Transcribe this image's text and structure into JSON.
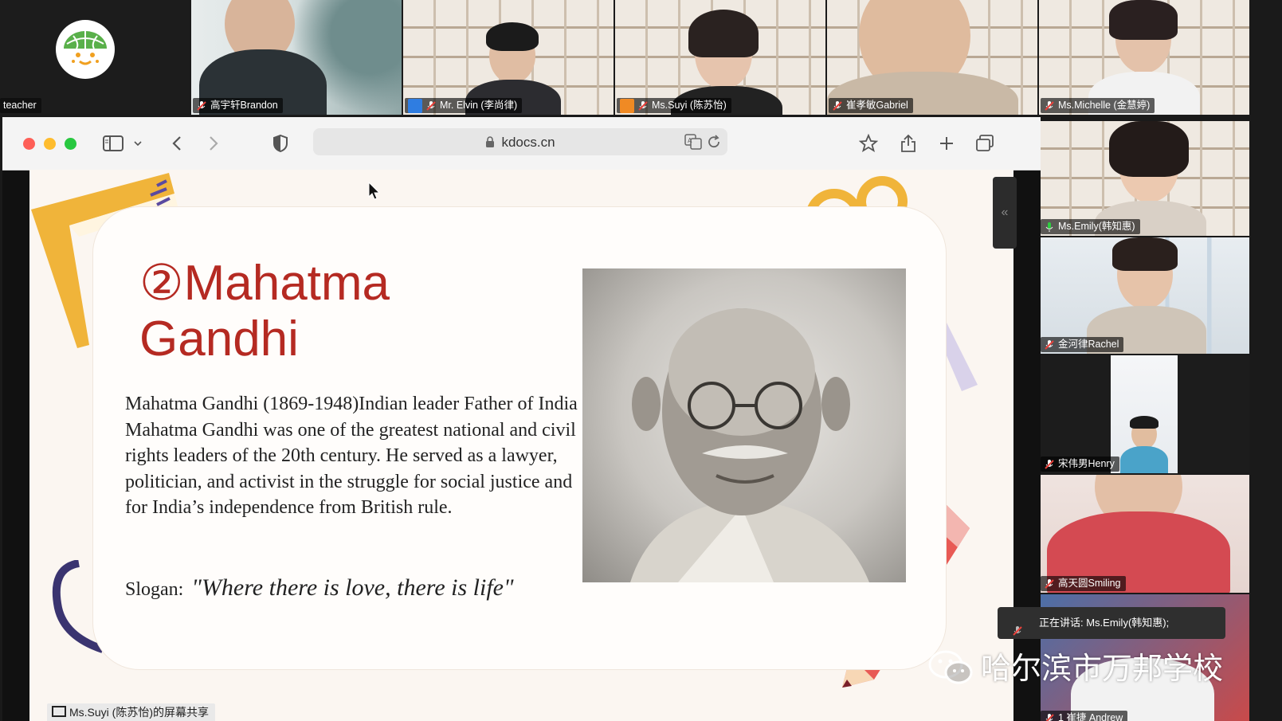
{
  "participants_top": [
    {
      "name": "teacher",
      "mic": "muted"
    },
    {
      "name": "高宇轩Brandon",
      "mic": "muted"
    },
    {
      "name": "Mr. Elvin (李尚律)",
      "mic": "muted",
      "badge": "blue"
    },
    {
      "name": "Ms.Suyi (陈苏怡)",
      "mic": "muted",
      "badge": "orange"
    },
    {
      "name": "崔孝敏Gabriel",
      "mic": "muted"
    },
    {
      "name": "Ms.Michelle (金慧婷)",
      "mic": "muted"
    }
  ],
  "participants_side": [
    {
      "name": "Ms.Emily(韩知惠)",
      "mic": "active"
    },
    {
      "name": "金河律Rachel",
      "mic": "muted"
    },
    {
      "name": "宋伟男Henry",
      "mic": "muted"
    },
    {
      "name": "高天圆Smiling",
      "mic": "muted"
    },
    {
      "name": "1 崔捷 Andrew",
      "mic": "muted"
    }
  ],
  "browser": {
    "url": "kdocs.cn"
  },
  "slide": {
    "title_line1": "②Mahatma",
    "title_line2": "Gandhi",
    "body": [
      "Mahatma Gandhi (1869-1948)Indian leader Father of India",
      "Mahatma Gandhi was one of the greatest national and civil rights leaders of the 20th century. He served as a lawyer, politician, and activist in the struggle for social justice and for India’s independence from British rule."
    ],
    "slogan_label": "Slogan:",
    "slogan_quote": "\"Where there is love, there is life\""
  },
  "share_label": "Ms.Suyi (陈苏怡)的屏幕共享",
  "speaking_label": "正在讲话: Ms.Emily(韩知惠);",
  "watermark": "哈尔滨市万邦学校",
  "colors": {
    "title_red": "#b52a22",
    "mic_muted": "#e8413b",
    "mic_active": "#2ecc40"
  }
}
